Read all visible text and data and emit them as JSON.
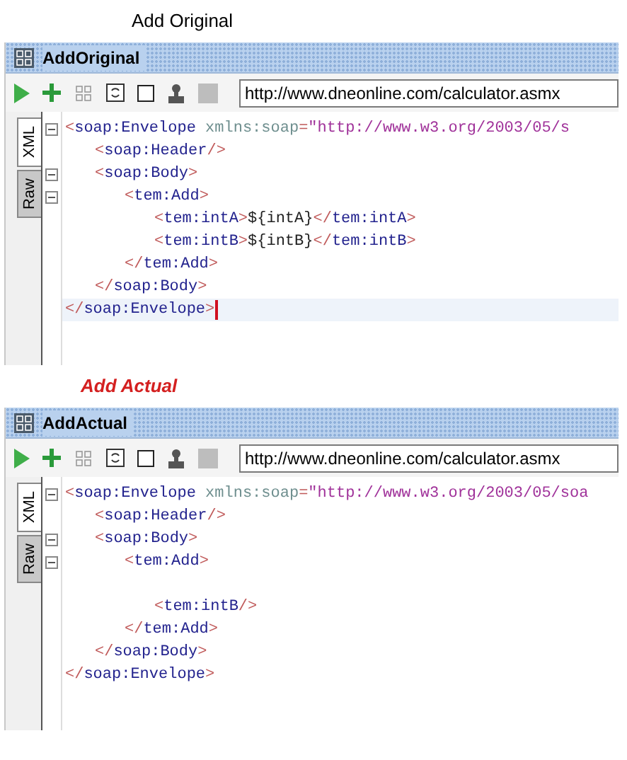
{
  "panels": [
    {
      "heading": {
        "text": "Add Original",
        "kind": "plain",
        "color": "#000000"
      },
      "window": {
        "title": "AddOriginal"
      },
      "url": "http://www.dneonline.com/calculator.asmx",
      "tabs": [
        {
          "label": "XML",
          "selected": true
        },
        {
          "label": "Raw",
          "selected": false
        }
      ],
      "lines": [
        {
          "kind": "code",
          "fold": true,
          "current": false,
          "tokens": [
            {
              "kind": "bracket",
              "text": "<"
            },
            {
              "kind": "tag",
              "text": "soap:Envelope"
            },
            {
              "kind": "attr",
              "text": " xmlns:soap"
            },
            {
              "kind": "bracket",
              "text": "="
            },
            {
              "kind": "value",
              "text": "\"http://www.w3.org/2003/05/s"
            }
          ],
          "children": [
            {
              "kind": "code",
              "fold": false,
              "current": false,
              "tokens": [
                {
                  "kind": "bracket",
                  "text": "<"
                },
                {
                  "kind": "tag",
                  "text": "soap:Header"
                },
                {
                  "kind": "bracket",
                  "text": "/>"
                }
              ]
            },
            {
              "kind": "code",
              "fold": true,
              "current": false,
              "tokens": [
                {
                  "kind": "bracket",
                  "text": "<"
                },
                {
                  "kind": "tag",
                  "text": "soap:Body"
                },
                {
                  "kind": "bracket",
                  "text": ">"
                }
              ],
              "children": [
                {
                  "kind": "code",
                  "fold": true,
                  "current": false,
                  "tokens": [
                    {
                      "kind": "bracket",
                      "text": "<"
                    },
                    {
                      "kind": "tag",
                      "text": "tem:Add"
                    },
                    {
                      "kind": "bracket",
                      "text": ">"
                    }
                  ],
                  "children": [
                    {
                      "kind": "code",
                      "fold": false,
                      "current": false,
                      "tokens": [
                        {
                          "kind": "bracket",
                          "text": "<"
                        },
                        {
                          "kind": "tag",
                          "text": "tem:intA"
                        },
                        {
                          "kind": "bracket",
                          "text": ">"
                        },
                        {
                          "kind": "text",
                          "text": "${intA}"
                        },
                        {
                          "kind": "bracket",
                          "text": "</"
                        },
                        {
                          "kind": "tag",
                          "text": "tem:intA"
                        },
                        {
                          "kind": "bracket",
                          "text": ">"
                        }
                      ]
                    },
                    {
                      "kind": "code",
                      "fold": false,
                      "current": false,
                      "tokens": [
                        {
                          "kind": "bracket",
                          "text": "<"
                        },
                        {
                          "kind": "tag",
                          "text": "tem:intB"
                        },
                        {
                          "kind": "bracket",
                          "text": ">"
                        },
                        {
                          "kind": "text",
                          "text": "${intB}"
                        },
                        {
                          "kind": "bracket",
                          "text": "</"
                        },
                        {
                          "kind": "tag",
                          "text": "tem:intB"
                        },
                        {
                          "kind": "bracket",
                          "text": ">"
                        }
                      ]
                    }
                  ]
                },
                {
                  "kind": "code",
                  "fold": false,
                  "current": false,
                  "tokens": [
                    {
                      "kind": "bracket",
                      "text": "</"
                    },
                    {
                      "kind": "tag",
                      "text": "tem:Add"
                    },
                    {
                      "kind": "bracket",
                      "text": ">"
                    }
                  ]
                }
              ]
            },
            {
              "kind": "code",
              "fold": false,
              "current": false,
              "tokens": [
                {
                  "kind": "bracket",
                  "text": "</"
                },
                {
                  "kind": "tag",
                  "text": "soap:Body"
                },
                {
                  "kind": "bracket",
                  "text": ">"
                }
              ]
            }
          ]
        },
        {
          "kind": "code",
          "fold": false,
          "current": true,
          "tokens": [
            {
              "kind": "bracket",
              "text": "</"
            },
            {
              "kind": "tag",
              "text": "soap:Envelope"
            },
            {
              "kind": "bracket",
              "text": ">"
            }
          ]
        }
      ]
    },
    {
      "heading": {
        "text": "Add Actual",
        "kind": "emphasis",
        "color": "#d42020"
      },
      "window": {
        "title": "AddActual"
      },
      "url": "http://www.dneonline.com/calculator.asmx",
      "tabs": [
        {
          "label": "XML",
          "selected": true
        },
        {
          "label": "Raw",
          "selected": false
        }
      ],
      "lines": [
        {
          "kind": "code",
          "fold": true,
          "current": false,
          "tokens": [
            {
              "kind": "bracket",
              "text": "<"
            },
            {
              "kind": "tag",
              "text": "soap:Envelope"
            },
            {
              "kind": "attr",
              "text": " xmlns:soap"
            },
            {
              "kind": "bracket",
              "text": "="
            },
            {
              "kind": "value",
              "text": "\"http://www.w3.org/2003/05/soa"
            }
          ],
          "children": [
            {
              "kind": "code",
              "fold": false,
              "current": false,
              "tokens": [
                {
                  "kind": "bracket",
                  "text": "<"
                },
                {
                  "kind": "tag",
                  "text": "soap:Header"
                },
                {
                  "kind": "bracket",
                  "text": "/>"
                }
              ]
            },
            {
              "kind": "code",
              "fold": true,
              "current": false,
              "tokens": [
                {
                  "kind": "bracket",
                  "text": "<"
                },
                {
                  "kind": "tag",
                  "text": "soap:Body"
                },
                {
                  "kind": "bracket",
                  "text": ">"
                }
              ],
              "children": [
                {
                  "kind": "code",
                  "fold": true,
                  "current": false,
                  "tokens": [
                    {
                      "kind": "bracket",
                      "text": "<"
                    },
                    {
                      "kind": "tag",
                      "text": "tem:Add"
                    },
                    {
                      "kind": "bracket",
                      "text": ">"
                    }
                  ],
                  "children": [
                    {
                      "kind": "blank"
                    },
                    {
                      "kind": "code",
                      "fold": false,
                      "current": false,
                      "tokens": [
                        {
                          "kind": "bracket",
                          "text": "<"
                        },
                        {
                          "kind": "tag",
                          "text": "tem:intB"
                        },
                        {
                          "kind": "bracket",
                          "text": "/>"
                        }
                      ]
                    }
                  ]
                },
                {
                  "kind": "code",
                  "fold": false,
                  "current": false,
                  "tokens": [
                    {
                      "kind": "bracket",
                      "text": "</"
                    },
                    {
                      "kind": "tag",
                      "text": "tem:Add"
                    },
                    {
                      "kind": "bracket",
                      "text": ">"
                    }
                  ]
                }
              ]
            },
            {
              "kind": "code",
              "fold": false,
              "current": false,
              "tokens": [
                {
                  "kind": "bracket",
                  "text": "</"
                },
                {
                  "kind": "tag",
                  "text": "soap:Body"
                },
                {
                  "kind": "bracket",
                  "text": ">"
                }
              ]
            }
          ]
        },
        {
          "kind": "code",
          "fold": false,
          "current": false,
          "tokens": [
            {
              "kind": "bracket",
              "text": "</"
            },
            {
              "kind": "tag",
              "text": "soap:Envelope"
            },
            {
              "kind": "bracket",
              "text": ">"
            }
          ]
        }
      ]
    }
  ]
}
